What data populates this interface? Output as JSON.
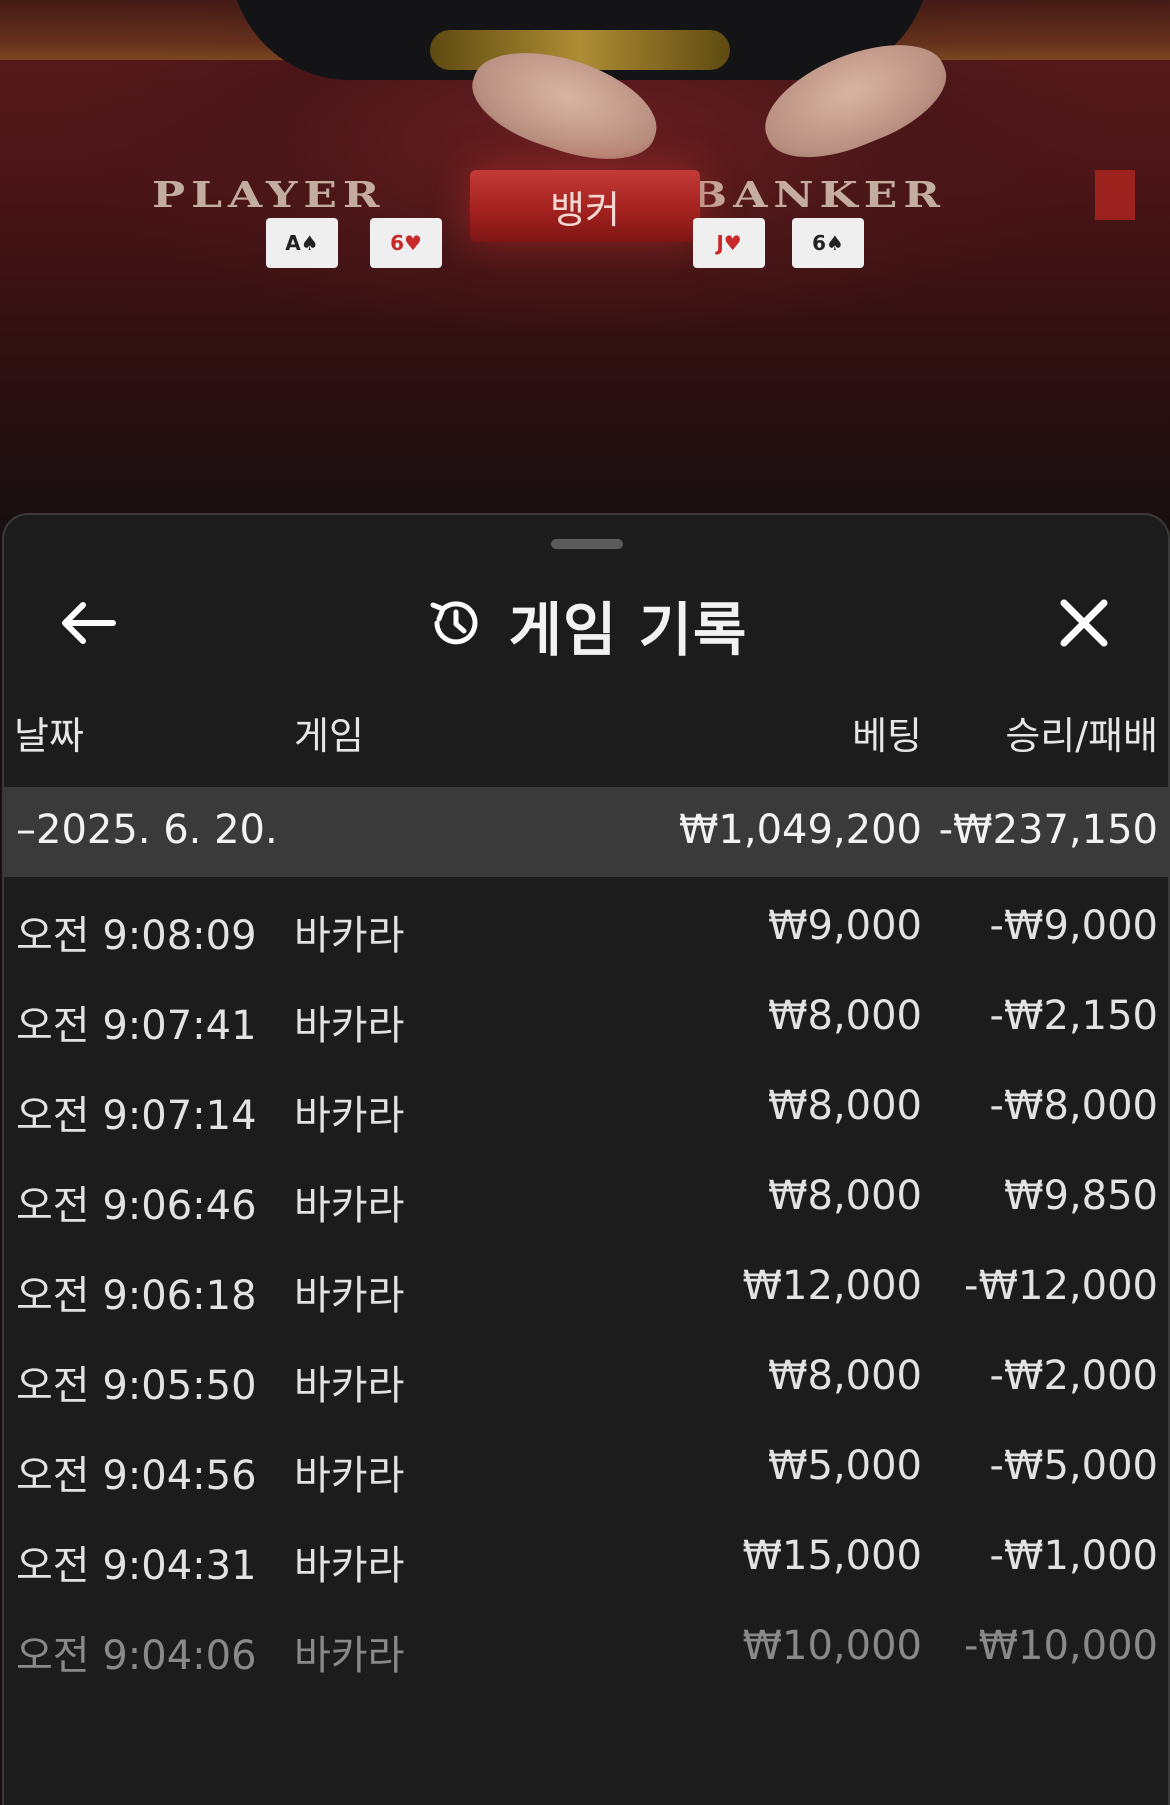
{
  "video": {
    "player_label": "PLAYER",
    "banker_label": "BANKER",
    "result_banner": "뱅커",
    "player_cards": [
      {
        "rank": "A♠",
        "color": "black"
      },
      {
        "rank": "6♥",
        "color": "red"
      }
    ],
    "banker_cards": [
      {
        "rank": "J♥",
        "color": "red"
      },
      {
        "rank": "6♠",
        "color": "black"
      }
    ]
  },
  "sheet": {
    "title": "게임 기록",
    "title_icon": "history-icon",
    "back_icon": "arrow-left-icon",
    "close_icon": "close-icon"
  },
  "columns": {
    "date": "날짜",
    "game": "게임",
    "bet": "베팅",
    "win_loss": "승리/패배"
  },
  "summary": {
    "date": "–2025. 6. 20.",
    "bet": "₩1,049,200",
    "win_loss": "-₩237,150"
  },
  "rows": [
    {
      "time": "오전 9:08:09",
      "game": "바카라",
      "bet": "₩9,000",
      "win_loss": "-₩9,000"
    },
    {
      "time": "오전 9:07:41",
      "game": "바카라",
      "bet": "₩8,000",
      "win_loss": "-₩2,150"
    },
    {
      "time": "오전 9:07:14",
      "game": "바카라",
      "bet": "₩8,000",
      "win_loss": "-₩8,000"
    },
    {
      "time": "오전 9:06:46",
      "game": "바카라",
      "bet": "₩8,000",
      "win_loss": "₩9,850"
    },
    {
      "time": "오전 9:06:18",
      "game": "바카라",
      "bet": "₩12,000",
      "win_loss": "-₩12,000"
    },
    {
      "time": "오전 9:05:50",
      "game": "바카라",
      "bet": "₩8,000",
      "win_loss": "-₩2,000"
    },
    {
      "time": "오전 9:04:56",
      "game": "바카라",
      "bet": "₩5,000",
      "win_loss": "-₩5,000"
    },
    {
      "time": "오전 9:04:31",
      "game": "바카라",
      "bet": "₩15,000",
      "win_loss": "-₩1,000"
    },
    {
      "time": "오전 9:04:06",
      "game": "바카라",
      "bet": "₩10,000",
      "win_loss": "-₩10,000"
    }
  ],
  "colors": {
    "sheet_bg": "#1c1c1c",
    "summary_bg": "#3a3a3a",
    "banner_red": "#a4221f"
  }
}
